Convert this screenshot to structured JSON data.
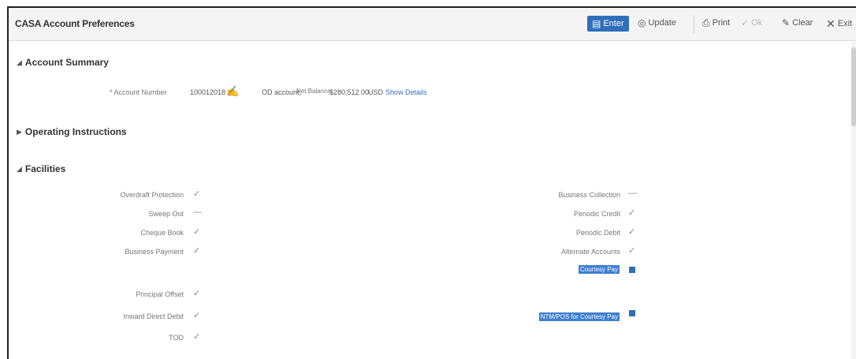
{
  "header": {
    "title": "CASA Account Preferences",
    "tools": {
      "enter": "Enter",
      "update": "Update",
      "print": "Print",
      "ok": "Ok",
      "clear": "Clear",
      "exit": "Exit"
    }
  },
  "sections": {
    "account_summary": "Account Summary",
    "operating_instructions": "Operating Instructions",
    "facilities": "Facilities"
  },
  "account": {
    "number_label": "* Account Number",
    "number_value": "100012018",
    "description": "OD account,",
    "net_balance_label": "Net Balance",
    "net_balance_value": "$280,512.00",
    "currency": "USD",
    "show_details": "Show Details"
  },
  "facilities_left": [
    {
      "label": "Overdraft Protection",
      "state": "checked"
    },
    {
      "label": "Sweep Out",
      "state": "dash"
    },
    {
      "label": "Cheque Book",
      "state": "checked"
    },
    {
      "label": "Business Payment",
      "state": "checked"
    },
    {
      "label": "Principal Offset",
      "state": "checked"
    },
    {
      "label": "Inward Direct Debit",
      "state": "checked"
    },
    {
      "label": "TOD",
      "state": "checked"
    }
  ],
  "facilities_right": [
    {
      "label": "Business Collection",
      "state": "dash"
    },
    {
      "label": "Periodic Credit",
      "state": "checked"
    },
    {
      "label": "Periodic Debit",
      "state": "checked"
    },
    {
      "label": "Alternate Accounts",
      "state": "checked"
    },
    {
      "label": "Courtesy Pay",
      "state": "selected"
    },
    {
      "label": "NTM/POS for Courtesy Pay",
      "state": "selected"
    }
  ],
  "glyphs": {
    "check": "✓",
    "dash": "—"
  }
}
